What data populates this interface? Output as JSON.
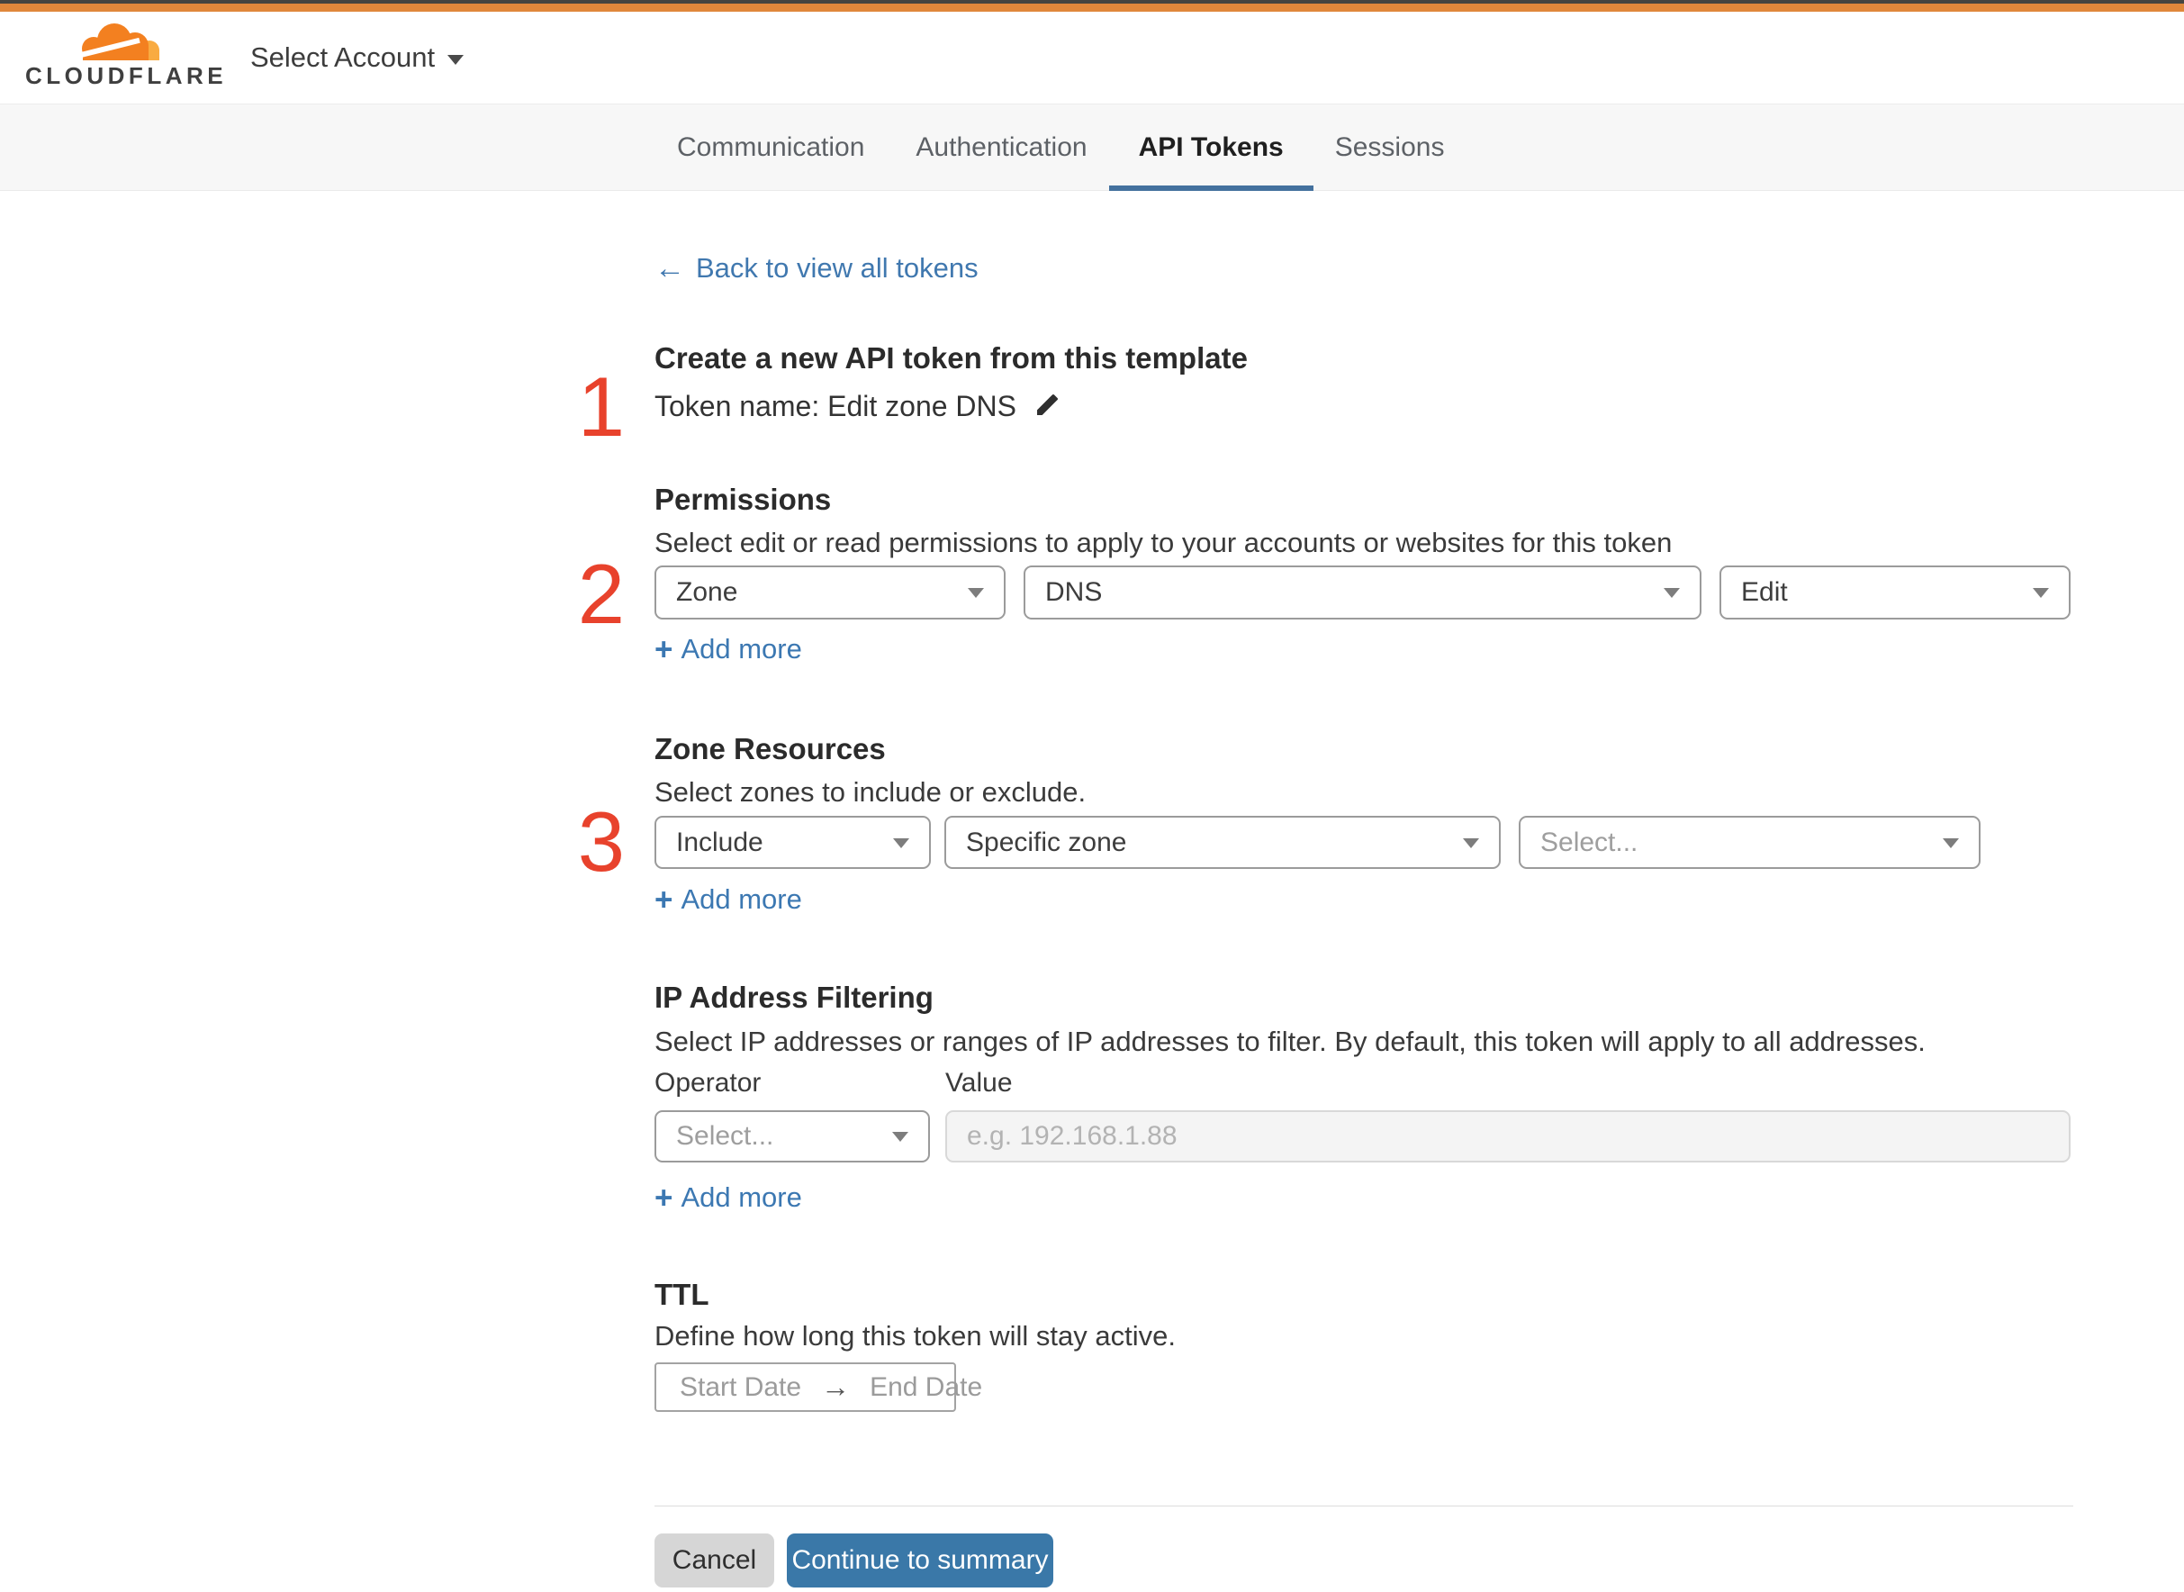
{
  "colors": {
    "accent_orange": "#e0873b",
    "step_red": "#e8422c",
    "link_blue": "#4078af",
    "button_blue": "#3a78a8",
    "tab_underline": "#44719e",
    "logo_orange": "#f38020",
    "logo_light_orange": "#f9ab41"
  },
  "header": {
    "brand": "CLOUDFLARE",
    "account_selector": "Select Account"
  },
  "nav": {
    "tabs": [
      {
        "label": "Communication",
        "active": false
      },
      {
        "label": "Authentication",
        "active": false
      },
      {
        "label": "API Tokens",
        "active": true
      },
      {
        "label": "Sessions",
        "active": false
      }
    ]
  },
  "main": {
    "back_link": "Back to view all tokens",
    "steps": {
      "one": "1",
      "two": "2",
      "three": "3"
    },
    "intro": {
      "title": "Create a new API token from this template",
      "token_line": "Token name: Edit zone DNS"
    },
    "permissions": {
      "title": "Permissions",
      "description": "Select edit or read permissions to apply to your accounts or websites for this token",
      "scope": "Zone",
      "permission_group": "DNS",
      "access_level": "Edit",
      "add_more": "Add more"
    },
    "zone_resources": {
      "title": "Zone Resources",
      "description": "Select zones to include or exclude.",
      "operator": "Include",
      "resource_type": "Specific zone",
      "zone_placeholder": "Select...",
      "add_more": "Add more"
    },
    "ip_filtering": {
      "title": "IP Address Filtering",
      "description": "Select IP addresses or ranges of IP addresses to filter. By default, this token will apply to all addresses.",
      "operator_label": "Operator",
      "value_label": "Value",
      "operator_placeholder": "Select...",
      "value_placeholder": "e.g. 192.168.1.88",
      "add_more": "Add more"
    },
    "ttl": {
      "title": "TTL",
      "description": "Define how long this token will stay active.",
      "start_date": "Start Date",
      "end_date": "End Date"
    },
    "footer": {
      "cancel": "Cancel",
      "continue": "Continue to summary"
    }
  },
  "icons": {
    "back_arrow": "←",
    "arrow_right": "→",
    "plus": "+"
  }
}
